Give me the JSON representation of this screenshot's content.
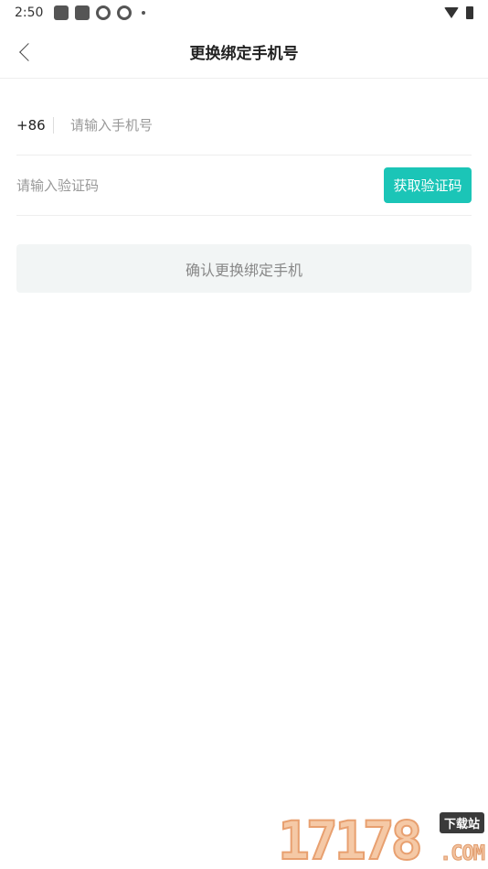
{
  "status_bar": {
    "time": "2:50"
  },
  "header": {
    "title": "更换绑定手机号"
  },
  "phone_row": {
    "country_code": "+86",
    "placeholder": "请输入手机号",
    "value": ""
  },
  "code_row": {
    "placeholder": "请输入验证码",
    "value": "",
    "get_code_label": "获取验证码"
  },
  "confirm": {
    "label": "确认更换绑定手机"
  },
  "watermark": {
    "digits": "17178",
    "badge": "下载站",
    "com": ".COM"
  },
  "colors": {
    "accent": "#1bc5b7",
    "disabled_button_bg": "#f2f5f5",
    "disabled_button_text": "#888888"
  },
  "icons": {
    "back": "chevron-left-icon",
    "wifi": "wifi-icon",
    "battery": "battery-icon"
  }
}
